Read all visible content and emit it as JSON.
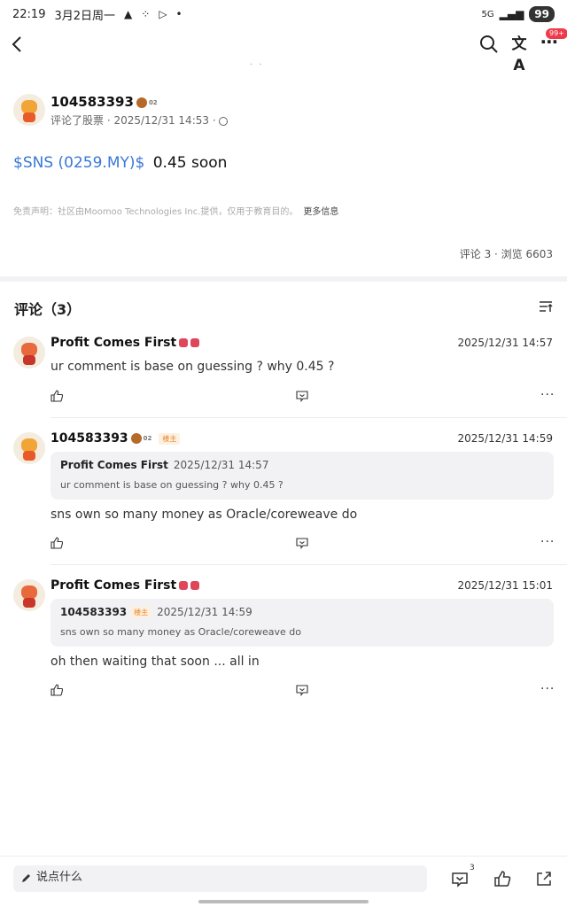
{
  "status_bar": {
    "time": "22:19",
    "date": "3月2日周一",
    "signal_text": "5G",
    "battery": "99"
  },
  "nav": {
    "badge": "99+"
  },
  "post": {
    "author": "104583393",
    "level": "02",
    "meta": "评论了股票 · 2025/12/31 14:53 ·",
    "ticker": "$SNS (0259.MY)$",
    "content": "0.45 soon",
    "disclaimer": "免责声明：社区由Moomoo Technologies Inc.提供，仅用于教育目的。",
    "more_info": "更多信息",
    "stats": "评论 3 · 浏览 6603"
  },
  "comments_title": "评论（3）",
  "comments": [
    {
      "name": "Profit Comes First",
      "time": "2025/12/31 14:57",
      "text": "ur comment is base on guessing ? why 0.45 ?"
    },
    {
      "name": "104583393",
      "level": "02",
      "tag": "楼主",
      "time": "2025/12/31 14:59",
      "quote_name": "Profit Comes First",
      "quote_time": "2025/12/31 14:57",
      "quote_text": "ur comment is base on guessing ? why 0.45 ?",
      "text": "sns own so many money as Oracle/coreweave do"
    },
    {
      "name": "Profit Comes First",
      "time": "2025/12/31 15:01",
      "quote_name": "104583393",
      "quote_tag": "楼主",
      "quote_time": "2025/12/31 14:59",
      "quote_text": "sns own so many money as Oracle/coreweave do",
      "text": "oh then waiting that soon ... all in"
    }
  ],
  "bottom_bar": {
    "placeholder": "说点什么",
    "comment_count": "3"
  },
  "icons": {
    "back": "back-arrow-icon",
    "search": "search-icon",
    "translate": "translate-icon",
    "more": "more-dots-icon",
    "sort": "sort-icon",
    "like": "thumbs-up-icon",
    "reply": "reply-icon",
    "share": "share-icon",
    "edit": "pencil-icon"
  },
  "colors": {
    "ticker_blue": "#3a78d8",
    "badge_red": "#ef3a4b",
    "op_tag_orange": "#e88a2a"
  }
}
